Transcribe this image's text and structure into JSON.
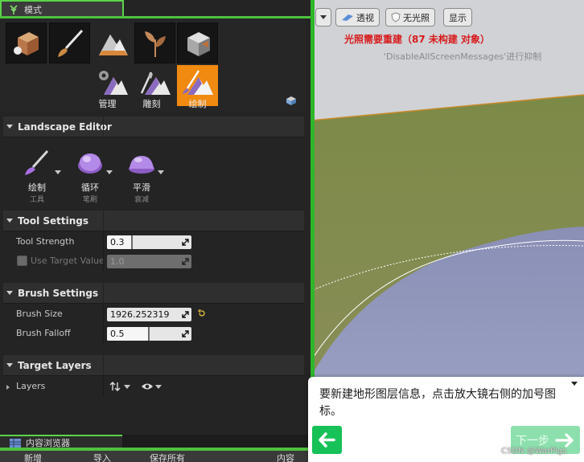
{
  "modes_tab": {
    "title": "模式"
  },
  "modes": [
    {
      "label": "管理",
      "icon": "landscape-manage-icon"
    },
    {
      "label": "雕刻",
      "icon": "landscape-sculpt-icon"
    },
    {
      "label": "绘制",
      "icon": "landscape-paint-icon",
      "active": true
    }
  ],
  "top_tool_icons": [
    "place-actor-icon",
    "paint-brush-icon",
    "landscape-mode-icon",
    "foliage-icon",
    "geometry-edit-icon"
  ],
  "landscape_editor": {
    "header": "Landscape Editor",
    "tools": [
      {
        "name": "绘制",
        "sub": "工具"
      },
      {
        "name": "循环",
        "sub": "笔刷"
      },
      {
        "name": "平滑",
        "sub": "衰减"
      }
    ]
  },
  "tool_settings": {
    "header": "Tool Settings",
    "tool_strength": {
      "label": "Tool Strength",
      "value": "0.3",
      "fraction": 0.3
    },
    "use_target_value": {
      "label": "Use Target Value",
      "value": "1.0",
      "checked": false
    }
  },
  "brush_settings": {
    "header": "Brush Settings",
    "brush_size": {
      "label": "Brush Size",
      "value": "1926.252319"
    },
    "brush_falloff": {
      "label": "Brush Falloff",
      "value": "0.5",
      "fraction": 0.5
    }
  },
  "target_layers": {
    "header": "Target Layers",
    "layers_label": "Layers"
  },
  "content_browser": {
    "tab_title": "内容浏览器",
    "toolbar": [
      "新增",
      "导入",
      "保存所有",
      "内容"
    ]
  },
  "viewport": {
    "buttons": [
      "透视",
      "无光照",
      "显示"
    ],
    "warning_main": "光照需要重建（87 未构建 对象）",
    "warning_sub": "'DisableAllScreenMessages'进行抑制"
  },
  "tutorial": {
    "text": "要新建地形图层信息，点击放大镜右侧的加号图标。",
    "next_label": "下一步"
  },
  "watermark": "CSDN @WarPigs",
  "colors": {
    "accent_green": "#4ec23e",
    "active_mode": "#f08a10",
    "warning_red": "#d81b1b"
  }
}
